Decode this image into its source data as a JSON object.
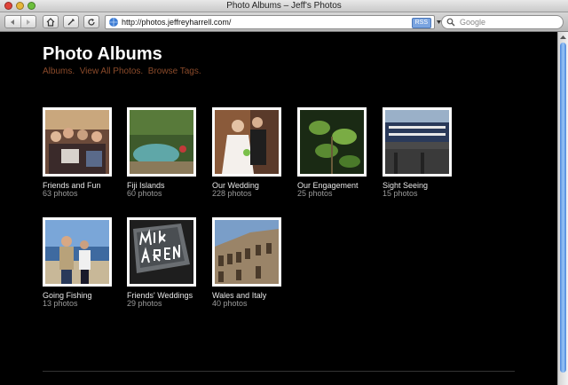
{
  "window": {
    "title": "Photo Albums – Jeff's Photos"
  },
  "toolbar": {
    "url": "http://photos.jeffreyharrell.com/",
    "rss_label": "RSS",
    "search_placeholder": "Google"
  },
  "page": {
    "title": "Photo Albums",
    "nav": [
      "Albums.",
      "View All Photos.",
      "Browse Tags."
    ]
  },
  "albums": [
    {
      "name": "Friends and Fun",
      "count": "63 photos"
    },
    {
      "name": "Fiji Islands",
      "count": "60 photos"
    },
    {
      "name": "Our Wedding",
      "count": "228 photos"
    },
    {
      "name": "Our Engagement",
      "count": "25 photos"
    },
    {
      "name": "Sight Seeing",
      "count": "15 photos"
    },
    {
      "name": "Going Fishing",
      "count": "13 photos"
    },
    {
      "name": "Friends' Weddings",
      "count": "29 photos"
    },
    {
      "name": "Wales and Italy",
      "count": "40 photos"
    }
  ],
  "colors": {
    "nav_link": "#8a4a2a",
    "background": "#000000",
    "scroll_thumb": "#4a86dc"
  }
}
